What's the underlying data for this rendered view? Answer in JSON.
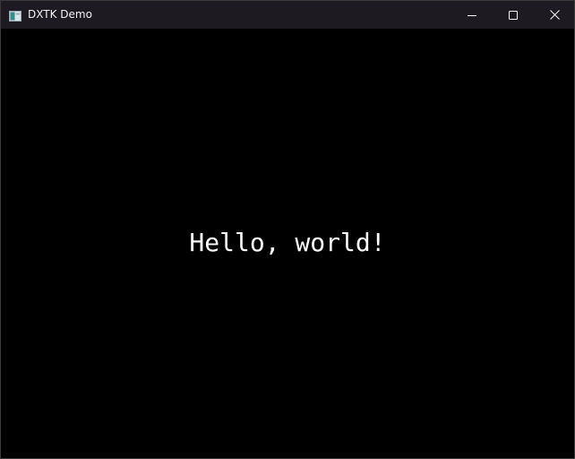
{
  "window": {
    "title": "DXTK Demo",
    "icon": "app-window-icon",
    "caption_buttons": {
      "minimize_icon": "minimize-icon",
      "maximize_icon": "maximize-icon",
      "close_icon": "close-icon"
    }
  },
  "client": {
    "text": "Hello, world!",
    "background": "#000000",
    "text_color": "#ffffff"
  }
}
